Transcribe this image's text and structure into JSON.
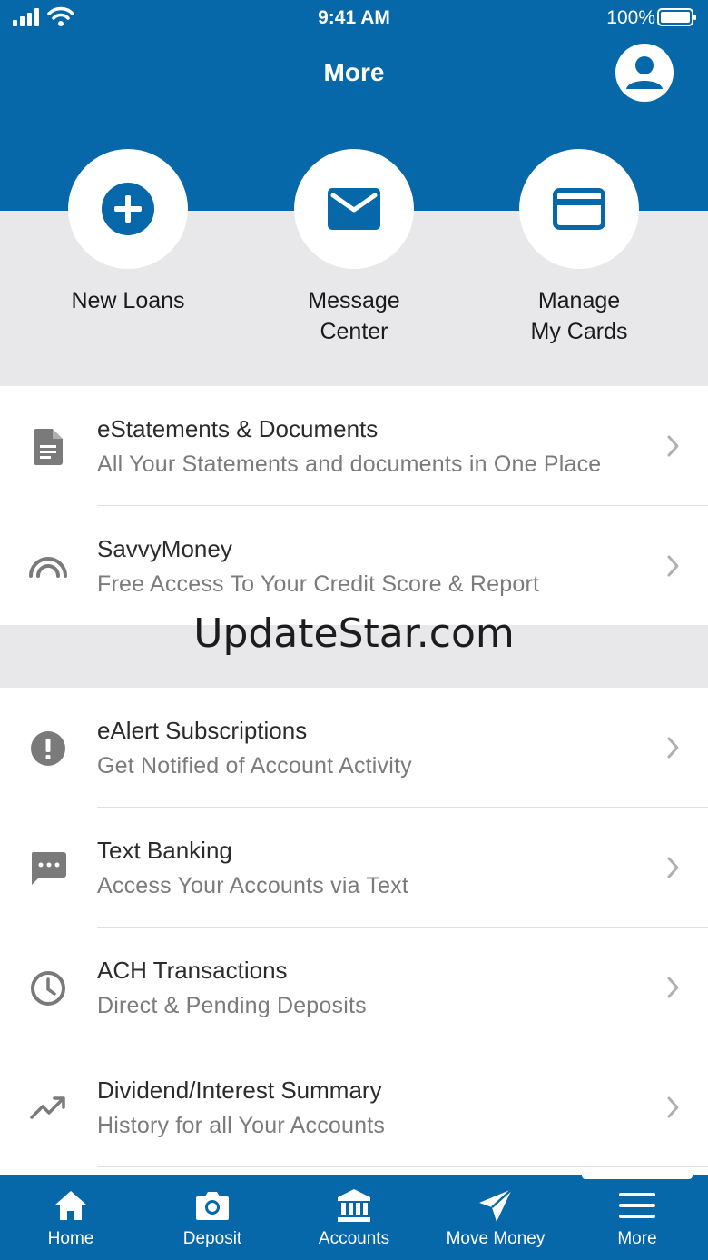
{
  "status_bar": {
    "time": "9:41 AM",
    "battery": "100%"
  },
  "header": {
    "title": "More"
  },
  "quick_actions": [
    {
      "label": "New Loans",
      "icon": "plus-circle-icon"
    },
    {
      "label": "Message\nCenter",
      "icon": "envelope-icon"
    },
    {
      "label": "Manage\nMy Cards",
      "icon": "credit-card-icon"
    }
  ],
  "section1": [
    {
      "title": "eStatements & Documents",
      "subtitle": "All Your Statements and documents in One Place",
      "icon": "document-icon"
    },
    {
      "title": "SavvyMoney",
      "subtitle": "Free Access To Your Credit Score & Report",
      "icon": "gauge-icon"
    }
  ],
  "watermark": "UpdateStar.com",
  "section2": [
    {
      "title": "eAlert Subscriptions",
      "subtitle": "Get Notified of Account Activity",
      "icon": "alert-icon"
    },
    {
      "title": "Text Banking",
      "subtitle": "Access Your Accounts via Text",
      "icon": "chat-icon"
    },
    {
      "title": "ACH Transactions",
      "subtitle": "Direct & Pending Deposits",
      "icon": "clock-icon"
    },
    {
      "title": "Dividend/Interest Summary",
      "subtitle": "History for all Your Accounts",
      "icon": "trending-up-icon"
    }
  ],
  "tabs": [
    {
      "label": "Home",
      "icon": "home-icon"
    },
    {
      "label": "Deposit",
      "icon": "camera-icon"
    },
    {
      "label": "Accounts",
      "icon": "bank-icon"
    },
    {
      "label": "Move Money",
      "icon": "send-icon"
    },
    {
      "label": "More",
      "icon": "menu-icon",
      "active": true
    }
  ],
  "colors": {
    "brand": "#0668a8",
    "background": "#e8e8ea",
    "icon_gray": "#7a7a7a"
  }
}
